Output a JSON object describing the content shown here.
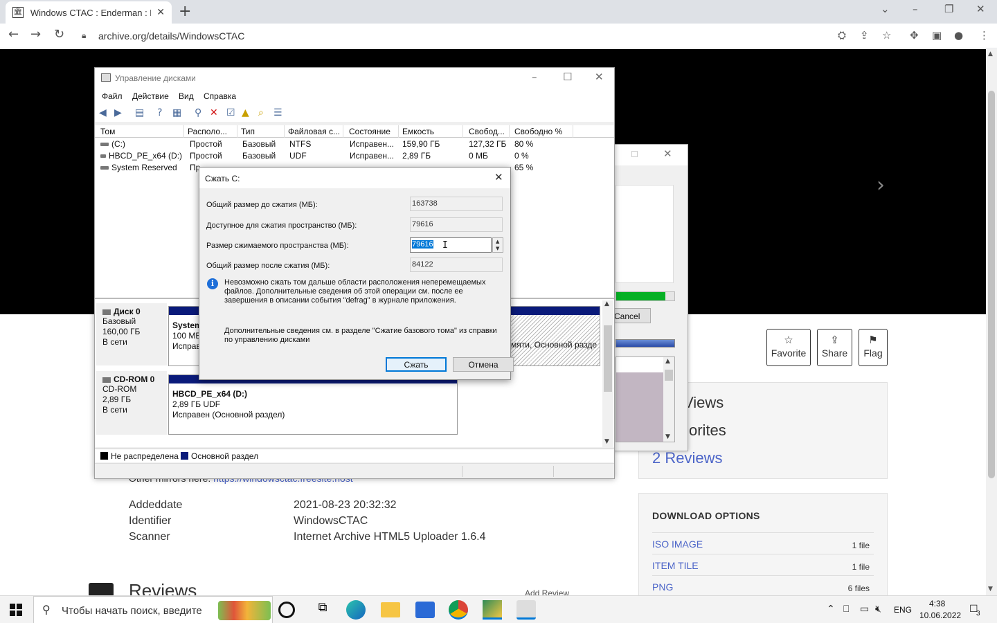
{
  "browser": {
    "tab_title": "Windows CTAC : Enderman : Free",
    "favicon": "archive-icon",
    "url": "archive.org/details/WindowsCTAC",
    "icons": [
      "back-icon",
      "forward-icon",
      "reload-icon",
      "lock-icon",
      "translate-icon",
      "share-icon",
      "star-icon",
      "extensions-icon",
      "sidebar-icon",
      "profile-icon",
      "menu-icon"
    ]
  },
  "page": {
    "actions": [
      {
        "icon": "star-icon",
        "label": "Favorite"
      },
      {
        "icon": "share-icon",
        "label": "Share"
      },
      {
        "icon": "flag-icon",
        "label": "Flag"
      }
    ],
    "stats": {
      "views": "Views",
      "favorites": "orites",
      "reviews_link": "2 Reviews"
    },
    "download": {
      "title": "DOWNLOAD OPTIONS",
      "items": [
        {
          "name": "ISO IMAGE",
          "count": "1 file"
        },
        {
          "name": "ITEM TILE",
          "count": "1 file"
        },
        {
          "name": "PNG",
          "count": "6 files"
        }
      ]
    },
    "mirrors_label": "Other mirrors here:",
    "mirrors_link": "https://windowsctac.freesite.host",
    "metadata": [
      {
        "label": "Addeddate",
        "value": "2021-08-23 20:32:32"
      },
      {
        "label": "Identifier",
        "value": "WindowsCTAC"
      },
      {
        "label": "Scanner",
        "value": "Internet Archive HTML5 Uploader 1.6.4"
      }
    ],
    "reviews_heading": "Reviews",
    "add_review": "Add Review"
  },
  "disk_mgmt": {
    "title": "Управление дисками",
    "menu": [
      "Файл",
      "Действие",
      "Вид",
      "Справка"
    ],
    "columns": [
      "Том",
      "Располо...",
      "Тип",
      "Файловая с...",
      "Состояние",
      "Емкость",
      "Свобод...",
      "Свободно %"
    ],
    "volumes": [
      {
        "name": "(C:)",
        "layout": "Простой",
        "type": "Базовый",
        "fs": "NTFS",
        "status": "Исправен...",
        "capacity": "159,90 ГБ",
        "free": "127,32 ГБ",
        "pct": "80 %"
      },
      {
        "name": "HBCD_PE_x64 (D:)",
        "layout": "Простой",
        "type": "Базовый",
        "fs": "UDF",
        "status": "Исправен...",
        "capacity": "2,89 ГБ",
        "free": "0 МБ",
        "pct": "0 %"
      },
      {
        "name": "System Reserved",
        "layout": "Пр",
        "type": "",
        "fs": "",
        "status": "",
        "capacity": "",
        "free": "",
        "pct": "65 %"
      }
    ],
    "disk0": {
      "name": "Диск 0",
      "type": "Базовый",
      "size": "160,00 ГБ",
      "state": "В сети",
      "part1_name": "System",
      "part1_size": "100 МБ",
      "part1_status": "Исправ",
      "part2_text": "мяти, Основной разде"
    },
    "cdrom": {
      "name": "CD-ROM 0",
      "type": "CD-ROM",
      "size": "2,89 ГБ",
      "state": "В сети",
      "part_name": "HBCD_PE_x64  (D:)",
      "part_size": "2,89 ГБ UDF",
      "part_status": "Исправен (Основной раздел)"
    },
    "legend": [
      {
        "label": "Не распределена",
        "color": "#000000"
      },
      {
        "label": "Основной раздел",
        "color": "#0a1a7a"
      }
    ]
  },
  "wizard": {
    "cancel_label": "Cancel",
    "progress_percent": 85
  },
  "shrink_dialog": {
    "title": "Сжать C:",
    "total_label": "Общий размер до сжатия (МБ):",
    "total_value": "163738",
    "available_label": "Доступное для сжатия пространство (МБ):",
    "available_value": "79616",
    "shrink_label": "Размер сжимаемого пространства (МБ):",
    "shrink_value": "79616",
    "after_label": "Общий размер после сжатия (МБ):",
    "after_value": "84122",
    "info_text": "Невозможно сжать том дальше области расположения неперемещаемых файлов. Дополнительные сведения об этой операции см. после ее завершения в описании события \"defrag\" в журнале приложения.",
    "more_text": "Дополнительные сведения см. в разделе \"Сжатие базового тома\" из справки по управлению дисками",
    "shrink_button": "Сжать",
    "cancel_button": "Отмена"
  },
  "taskbar": {
    "search_placeholder": "Чтобы начать поиск, введите",
    "lang": "ENG",
    "time": "4:38",
    "date": "10.06.2022",
    "notifications": "3"
  }
}
